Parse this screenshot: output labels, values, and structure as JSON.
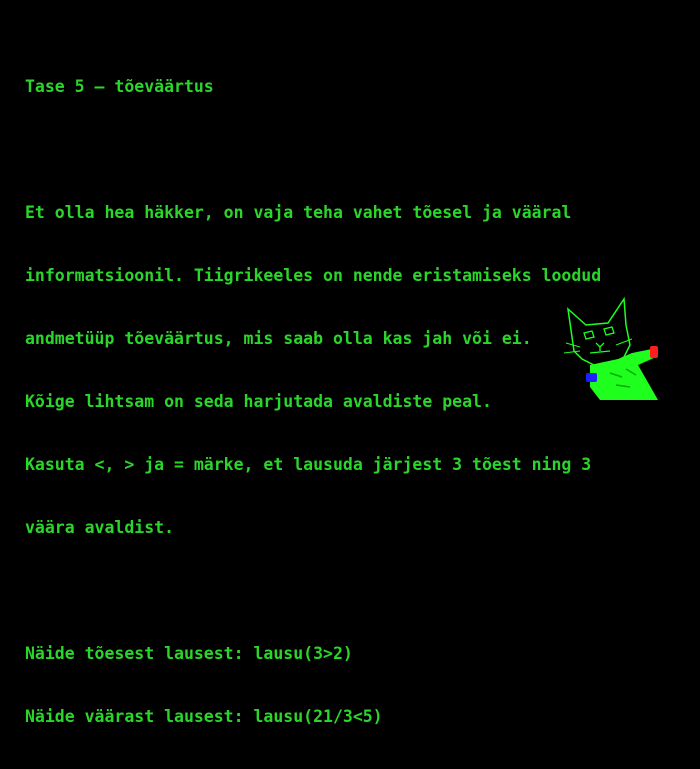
{
  "title": "Tase 5 – tõeväärtus",
  "paragraph": [
    "Et olla hea häkker, on vaja teha vahet tõesel ja vääral",
    "informatsioonil. Tiigrikeeles on nende eristamiseks loodud",
    "andmetüüp tõeväärtus, mis saab olla kas jah või ei.",
    "Kõige lihtsam on seda harjutada avaldiste peal.",
    "Kasuta <, > ja = märke, et lausuda järjest 3 tõest ning 3",
    "väära avaldist."
  ],
  "examples": [
    "Näide tõesest lausest: lausu(3>2)",
    "Näide väärast lausest: lausu(21/3<5)"
  ],
  "colors": {
    "background": "#000000",
    "text": "#2bd62b",
    "cat_body": "#1eff1e",
    "cat_outline": "#1eff1e",
    "cat_hand_red": "#ff1e1e",
    "cat_hand_blue": "#1e1eff"
  },
  "icons": {
    "mascot": "tiger-cat-icon"
  }
}
